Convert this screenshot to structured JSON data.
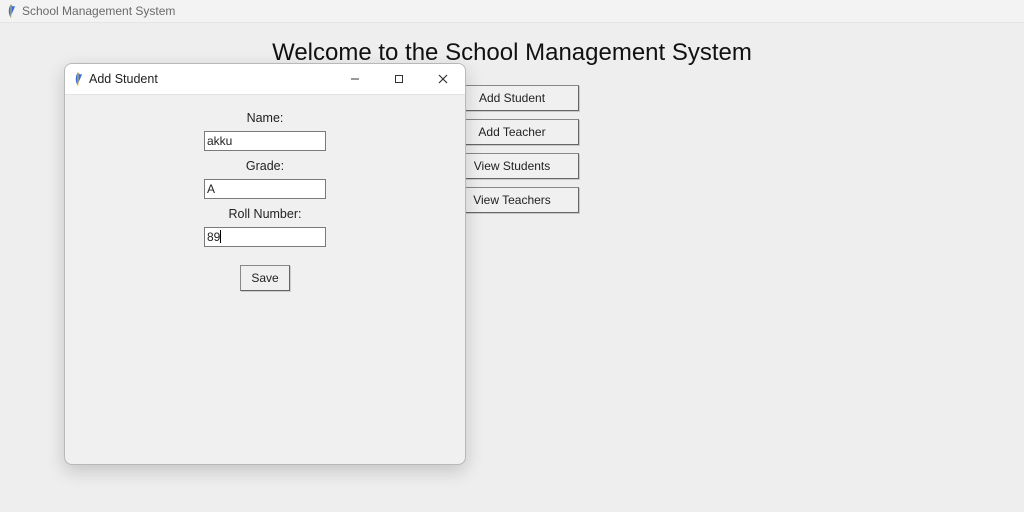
{
  "main_window": {
    "title": "School Management System"
  },
  "welcome_heading": "Welcome to the School Management System",
  "buttons": {
    "add_student": "Add Student",
    "add_teacher": "Add Teacher",
    "view_students": "View Students",
    "view_teachers": "View Teachers"
  },
  "dialog": {
    "title": "Add Student",
    "fields": {
      "name_label": "Name:",
      "name_value": "akku",
      "grade_label": "Grade:",
      "grade_value": "A",
      "roll_label": "Roll Number:",
      "roll_value": "89"
    },
    "save_label": "Save"
  }
}
